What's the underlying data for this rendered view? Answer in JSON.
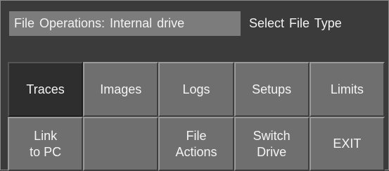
{
  "header": {
    "location_label": "File Operations: Internal drive",
    "prompt": "Select File Type"
  },
  "softkeys": {
    "row1": [
      {
        "label": "Traces",
        "selected": true
      },
      {
        "label": "Images",
        "selected": false
      },
      {
        "label": "Logs",
        "selected": false
      },
      {
        "label": "Setups",
        "selected": false
      },
      {
        "label": "Limits",
        "selected": false
      }
    ],
    "row2": [
      {
        "label": "Link\nto PC"
      },
      {
        "label": ""
      },
      {
        "label": "File\nActions"
      },
      {
        "label": "Switch\nDrive"
      },
      {
        "label": "EXIT"
      }
    ]
  },
  "colors": {
    "background": "#3b3b3b",
    "softkey": "#6f6f6f",
    "softkey_selected": "#2e2e2e",
    "header_highlight": "#7c7c7c",
    "text": "#f2f2f2"
  }
}
